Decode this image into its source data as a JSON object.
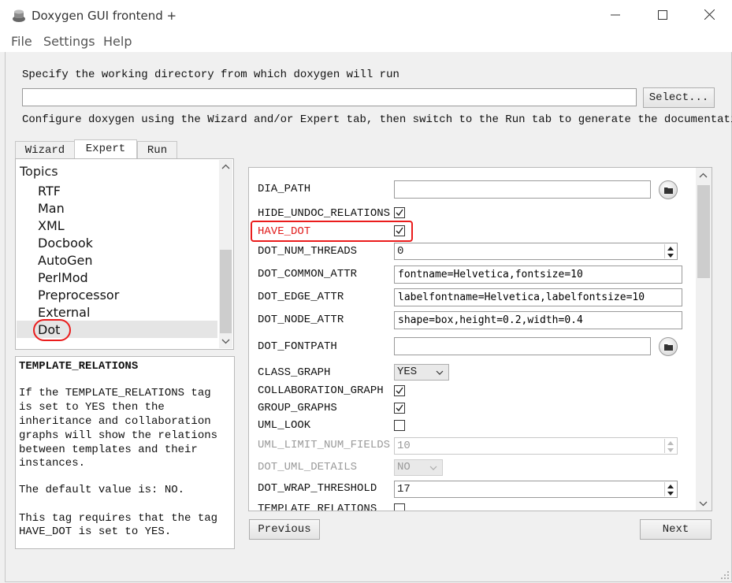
{
  "window": {
    "title": "Doxygen GUI frontend +"
  },
  "menu": [
    "File",
    "Settings",
    "Help"
  ],
  "workdir": {
    "label": "Specify the working directory from which doxygen will run",
    "value": "",
    "select_button": "Select...",
    "hint": "Configure doxygen using the Wizard and/or Expert tab, then switch to the Run tab to generate the documentation"
  },
  "tabs": [
    "Wizard",
    "Expert",
    "Run"
  ],
  "active_tab": "Expert",
  "topics": {
    "header": "Topics",
    "items": [
      "RTF",
      "Man",
      "XML",
      "Docbook",
      "AutoGen",
      "PerlMod",
      "Preprocessor",
      "External",
      "Dot"
    ],
    "selected": "Dot"
  },
  "description": {
    "title": "TEMPLATE_RELATIONS",
    "lines": [
      "If the TEMPLATE_RELATIONS tag",
      "is set to YES then the",
      "inheritance and collaboration",
      "graphs will show the relations",
      "between templates and their",
      "instances."
    ],
    "default_line": "The default value is: NO.",
    "requires_lines": [
      "This tag requires that the tag",
      "HAVE_DOT is set to YES."
    ]
  },
  "options": {
    "dia_path": {
      "label": "DIA_PATH",
      "value": ""
    },
    "hide_undoc_relations": {
      "label": "HIDE_UNDOC_RELATIONS",
      "checked": true
    },
    "have_dot": {
      "label": "HAVE_DOT",
      "checked": true
    },
    "dot_num_threads": {
      "label": "DOT_NUM_THREADS",
      "value": "0"
    },
    "dot_common_attr": {
      "label": "DOT_COMMON_ATTR",
      "value": "fontname=Helvetica,fontsize=10"
    },
    "dot_edge_attr": {
      "label": "DOT_EDGE_ATTR",
      "value": "labelfontname=Helvetica,labelfontsize=10"
    },
    "dot_node_attr": {
      "label": "DOT_NODE_ATTR",
      "value": "shape=box,height=0.2,width=0.4"
    },
    "dot_fontpath": {
      "label": "DOT_FONTPATH",
      "value": ""
    },
    "class_graph": {
      "label": "CLASS_GRAPH",
      "value": "YES"
    },
    "collaboration_graph": {
      "label": "COLLABORATION_GRAPH",
      "checked": true
    },
    "group_graphs": {
      "label": "GROUP_GRAPHS",
      "checked": true
    },
    "uml_look": {
      "label": "UML_LOOK",
      "checked": false
    },
    "uml_limit_num_fields": {
      "label": "UML_LIMIT_NUM_FIELDS",
      "value": "10"
    },
    "dot_uml_details": {
      "label": "DOT_UML_DETAILS",
      "value": "NO"
    },
    "dot_wrap_threshold": {
      "label": "DOT_WRAP_THRESHOLD",
      "value": "17"
    },
    "template_relations": {
      "label": "TEMPLATE_RELATIONS",
      "checked": false
    }
  },
  "nav": {
    "previous": "Previous",
    "next": "Next"
  },
  "colors": {
    "highlight": "#ea1c1c",
    "selection": "#e5e5e5"
  }
}
